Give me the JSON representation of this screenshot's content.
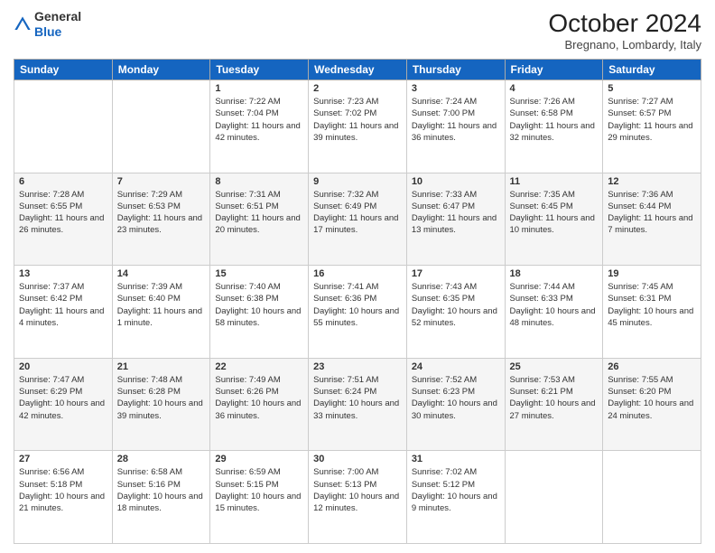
{
  "header": {
    "logo_general": "General",
    "logo_blue": "Blue",
    "title": "October 2024",
    "subtitle": "Bregnano, Lombardy, Italy"
  },
  "columns": [
    "Sunday",
    "Monday",
    "Tuesday",
    "Wednesday",
    "Thursday",
    "Friday",
    "Saturday"
  ],
  "weeks": [
    [
      {
        "day": "",
        "info": ""
      },
      {
        "day": "",
        "info": ""
      },
      {
        "day": "1",
        "info": "Sunrise: 7:22 AM\nSunset: 7:04 PM\nDaylight: 11 hours and 42 minutes."
      },
      {
        "day": "2",
        "info": "Sunrise: 7:23 AM\nSunset: 7:02 PM\nDaylight: 11 hours and 39 minutes."
      },
      {
        "day": "3",
        "info": "Sunrise: 7:24 AM\nSunset: 7:00 PM\nDaylight: 11 hours and 36 minutes."
      },
      {
        "day": "4",
        "info": "Sunrise: 7:26 AM\nSunset: 6:58 PM\nDaylight: 11 hours and 32 minutes."
      },
      {
        "day": "5",
        "info": "Sunrise: 7:27 AM\nSunset: 6:57 PM\nDaylight: 11 hours and 29 minutes."
      }
    ],
    [
      {
        "day": "6",
        "info": "Sunrise: 7:28 AM\nSunset: 6:55 PM\nDaylight: 11 hours and 26 minutes."
      },
      {
        "day": "7",
        "info": "Sunrise: 7:29 AM\nSunset: 6:53 PM\nDaylight: 11 hours and 23 minutes."
      },
      {
        "day": "8",
        "info": "Sunrise: 7:31 AM\nSunset: 6:51 PM\nDaylight: 11 hours and 20 minutes."
      },
      {
        "day": "9",
        "info": "Sunrise: 7:32 AM\nSunset: 6:49 PM\nDaylight: 11 hours and 17 minutes."
      },
      {
        "day": "10",
        "info": "Sunrise: 7:33 AM\nSunset: 6:47 PM\nDaylight: 11 hours and 13 minutes."
      },
      {
        "day": "11",
        "info": "Sunrise: 7:35 AM\nSunset: 6:45 PM\nDaylight: 11 hours and 10 minutes."
      },
      {
        "day": "12",
        "info": "Sunrise: 7:36 AM\nSunset: 6:44 PM\nDaylight: 11 hours and 7 minutes."
      }
    ],
    [
      {
        "day": "13",
        "info": "Sunrise: 7:37 AM\nSunset: 6:42 PM\nDaylight: 11 hours and 4 minutes."
      },
      {
        "day": "14",
        "info": "Sunrise: 7:39 AM\nSunset: 6:40 PM\nDaylight: 11 hours and 1 minute."
      },
      {
        "day": "15",
        "info": "Sunrise: 7:40 AM\nSunset: 6:38 PM\nDaylight: 10 hours and 58 minutes."
      },
      {
        "day": "16",
        "info": "Sunrise: 7:41 AM\nSunset: 6:36 PM\nDaylight: 10 hours and 55 minutes."
      },
      {
        "day": "17",
        "info": "Sunrise: 7:43 AM\nSunset: 6:35 PM\nDaylight: 10 hours and 52 minutes."
      },
      {
        "day": "18",
        "info": "Sunrise: 7:44 AM\nSunset: 6:33 PM\nDaylight: 10 hours and 48 minutes."
      },
      {
        "day": "19",
        "info": "Sunrise: 7:45 AM\nSunset: 6:31 PM\nDaylight: 10 hours and 45 minutes."
      }
    ],
    [
      {
        "day": "20",
        "info": "Sunrise: 7:47 AM\nSunset: 6:29 PM\nDaylight: 10 hours and 42 minutes."
      },
      {
        "day": "21",
        "info": "Sunrise: 7:48 AM\nSunset: 6:28 PM\nDaylight: 10 hours and 39 minutes."
      },
      {
        "day": "22",
        "info": "Sunrise: 7:49 AM\nSunset: 6:26 PM\nDaylight: 10 hours and 36 minutes."
      },
      {
        "day": "23",
        "info": "Sunrise: 7:51 AM\nSunset: 6:24 PM\nDaylight: 10 hours and 33 minutes."
      },
      {
        "day": "24",
        "info": "Sunrise: 7:52 AM\nSunset: 6:23 PM\nDaylight: 10 hours and 30 minutes."
      },
      {
        "day": "25",
        "info": "Sunrise: 7:53 AM\nSunset: 6:21 PM\nDaylight: 10 hours and 27 minutes."
      },
      {
        "day": "26",
        "info": "Sunrise: 7:55 AM\nSunset: 6:20 PM\nDaylight: 10 hours and 24 minutes."
      }
    ],
    [
      {
        "day": "27",
        "info": "Sunrise: 6:56 AM\nSunset: 5:18 PM\nDaylight: 10 hours and 21 minutes."
      },
      {
        "day": "28",
        "info": "Sunrise: 6:58 AM\nSunset: 5:16 PM\nDaylight: 10 hours and 18 minutes."
      },
      {
        "day": "29",
        "info": "Sunrise: 6:59 AM\nSunset: 5:15 PM\nDaylight: 10 hours and 15 minutes."
      },
      {
        "day": "30",
        "info": "Sunrise: 7:00 AM\nSunset: 5:13 PM\nDaylight: 10 hours and 12 minutes."
      },
      {
        "day": "31",
        "info": "Sunrise: 7:02 AM\nSunset: 5:12 PM\nDaylight: 10 hours and 9 minutes."
      },
      {
        "day": "",
        "info": ""
      },
      {
        "day": "",
        "info": ""
      }
    ]
  ]
}
